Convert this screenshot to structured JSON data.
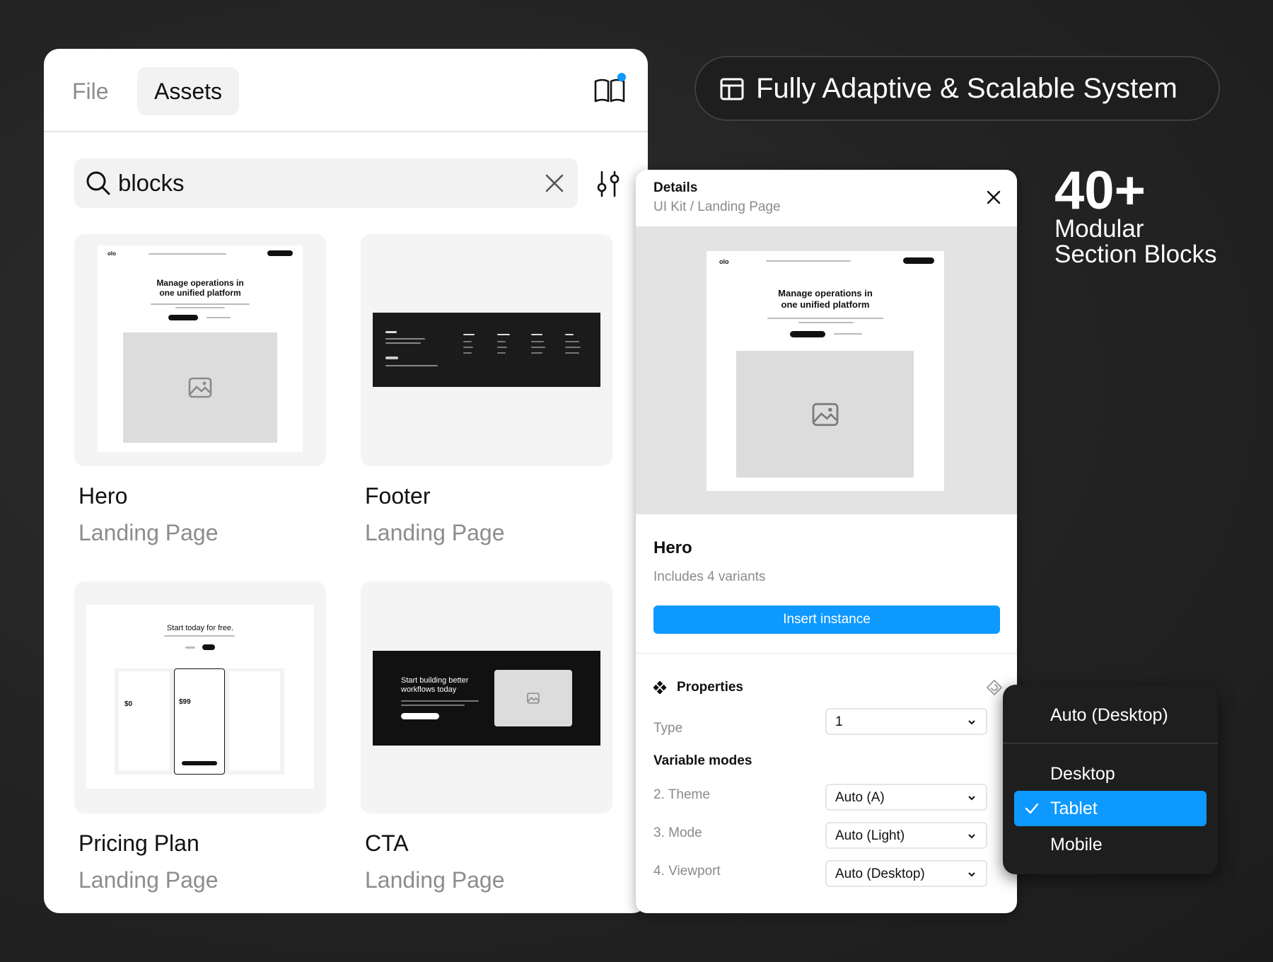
{
  "assets_panel": {
    "tabs": [
      "File",
      "Assets"
    ],
    "search": {
      "value": "blocks"
    },
    "cards": [
      {
        "title": "Hero",
        "subtitle": "Landing Page"
      },
      {
        "title": "Footer",
        "subtitle": "Landing Page"
      },
      {
        "title": "Pricing Plan",
        "subtitle": "Landing Page"
      },
      {
        "title": "CTA",
        "subtitle": "Landing Page"
      }
    ],
    "thumbs": {
      "hero_logo": "olo",
      "hero_heading_1": "Manage operations in",
      "hero_heading_2": "one unified platform",
      "pricing_heading": "Start today for free.",
      "pricing_price_low": "$0",
      "pricing_price_mid": "$99",
      "cta_heading_1": "Start building better",
      "cta_heading_2": "workflows today"
    }
  },
  "details_panel": {
    "title": "Details",
    "breadcrumb": "UI Kit / Landing Page",
    "component_name": "Hero",
    "variants_text": "Includes 4 variants",
    "insert_label": "Insert instance",
    "properties_title": "Properties",
    "type_label": "Type",
    "type_value": "1",
    "variable_modes_label": "Variable modes",
    "modes": [
      {
        "label": "2. Theme",
        "value": "Auto (A)"
      },
      {
        "label": "3. Mode",
        "value": "Auto (Light)"
      },
      {
        "label": "4. Viewport",
        "value": "Auto (Desktop)"
      }
    ]
  },
  "header": {
    "feature_text": "Fully Adaptive & Scalable System"
  },
  "stats": {
    "count": "40+",
    "caption_line1": "Modular",
    "caption_line2": "Section Blocks"
  },
  "dropdown": {
    "auto_option": "Auto (Desktop)",
    "options": [
      "Desktop",
      "Tablet",
      "Mobile"
    ],
    "selected": "Tablet"
  },
  "colors": {
    "accent": "#0d99ff",
    "background": "#232323",
    "panel": "#ffffff",
    "menu": "#1e1e1e"
  },
  "icons": [
    "library-icon",
    "search-icon",
    "clear-icon",
    "filter-icon",
    "close-icon",
    "image-icon",
    "properties-icon",
    "reset-icon",
    "chevron-down-icon",
    "layout-icon",
    "check-icon"
  ]
}
